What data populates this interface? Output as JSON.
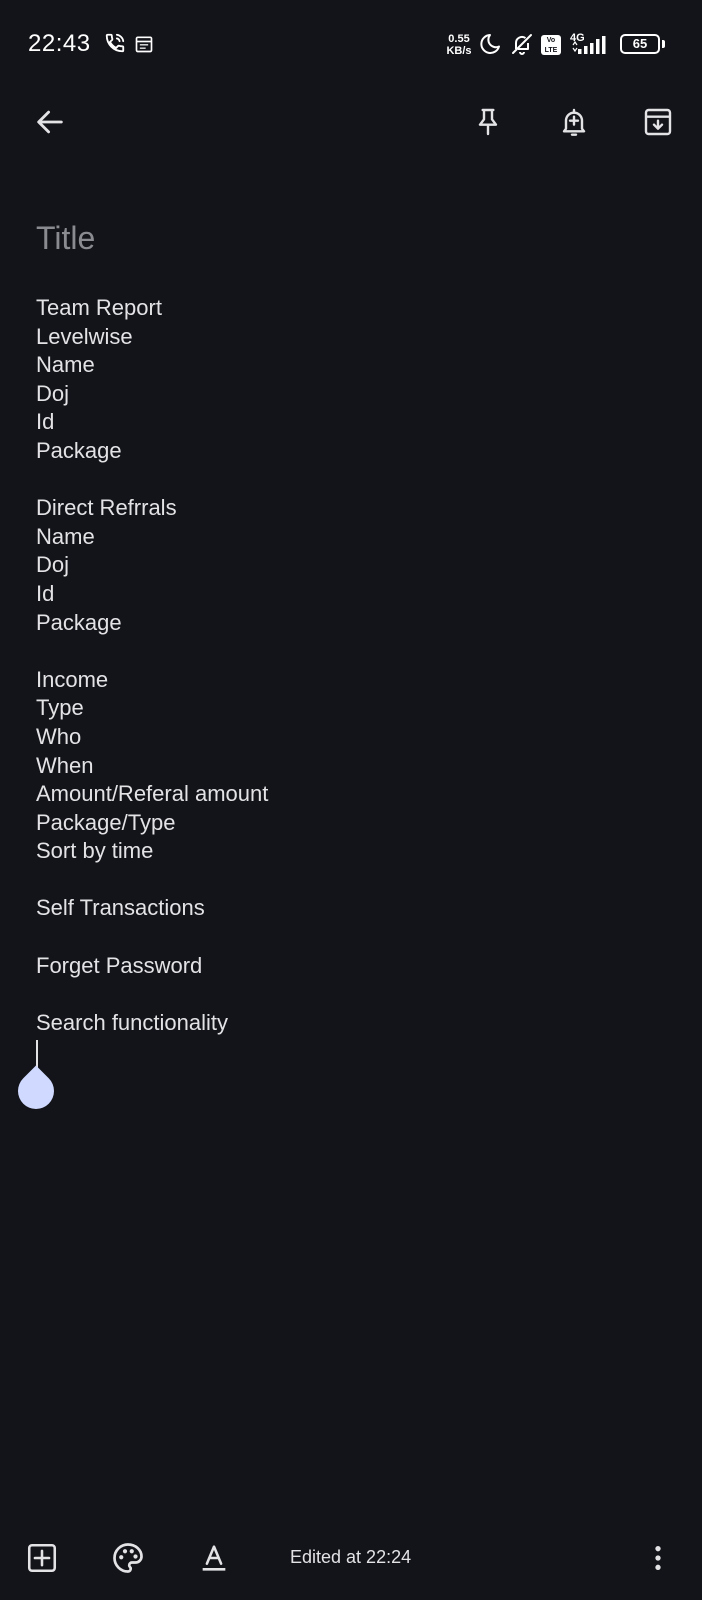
{
  "status_bar": {
    "time": "22:43",
    "net_speed_value": "0.55",
    "net_speed_unit": "KB/s",
    "volte_top": "Vo",
    "volte_bottom": "LTE",
    "network_type": "4G",
    "battery": "65",
    "icons": [
      "wifi-calling-icon",
      "calendar-icon",
      "moon-icon",
      "bell-off-icon",
      "signal-icon"
    ]
  },
  "toolbar": {
    "back_icon": "arrow-left-icon",
    "pin_icon": "pin-icon",
    "reminder_icon": "bell-plus-icon",
    "archive_icon": "archive-icon"
  },
  "note": {
    "title_placeholder": "Title",
    "lines": [
      "Team Report",
      "Levelwise",
      "Name",
      "Doj",
      "Id",
      "Package",
      "",
      "Direct Refrrals",
      "Name",
      "Doj",
      "Id",
      "Package",
      "",
      "Income",
      "Type",
      "Who",
      "When",
      "Amount/Referal amount",
      "Package/Type",
      "Sort by time",
      "",
      "Self Transactions",
      "",
      "Forget Password",
      "",
      "Search functionality"
    ]
  },
  "bottom_bar": {
    "add_icon": "add-box-icon",
    "palette_icon": "palette-icon",
    "text_format_icon": "text-format-icon",
    "edited_label": "Edited at 22:24",
    "more_icon": "more-vert-icon"
  },
  "colors": {
    "background": "#131419",
    "text": "#e3e3e6",
    "placeholder": "#8a8b91",
    "cursor_handle": "#d0d9ff"
  }
}
